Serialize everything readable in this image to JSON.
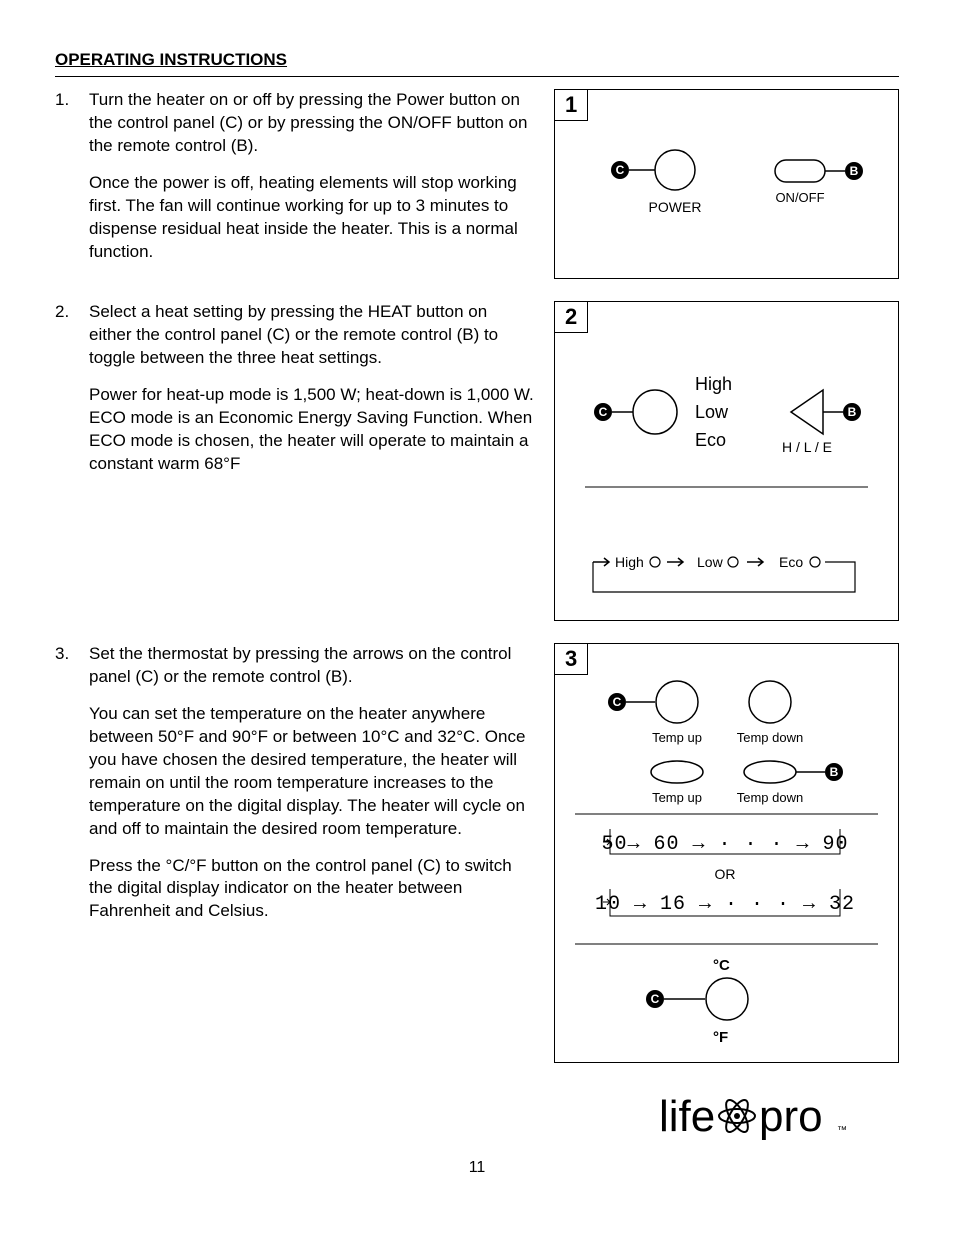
{
  "section_title": "OPERATING INSTRUCTIONS",
  "page_number": "11",
  "steps": [
    {
      "num": "1.",
      "paras": [
        "Turn the heater on or off by pressing the Power button on the control panel (C) or by pressing the ON/OFF button on the remote control (B).",
        "Once the power is off, heating elements will stop working first. The fan will continue working for up to 3 minutes to dispense residual heat inside the heater. This is a normal function."
      ]
    },
    {
      "num": "2.",
      "paras": [
        "Select a heat setting by pressing the HEAT button on either the control panel (C) or the remote control (B) to toggle between the three heat settings.",
        "Power for heat-up mode is 1,500 W; heat-down is 1,000 W. ECO mode is an Economic Energy Saving Function. When ECO mode is chosen, the heater will operate to maintain a constant warm 68°F"
      ]
    },
    {
      "num": "3.",
      "paras": [
        "Set the thermostat by pressing the arrows on the control panel (C) or the remote control (B).",
        "You can set the temperature on the heater anywhere between 50°F and 90°F or between 10°C and 32°C. Once you have chosen the desired temperature, the heater will remain on until the room temperature increases to the temperature on the digital display. The heater will cycle on and off to maintain the desired room temperature.",
        "Press the °C/°F button on the control panel (C) to switch the digital display indicator on the heater between Fahrenheit and Celsius."
      ]
    }
  ],
  "fig1": {
    "num": "1",
    "c": "C",
    "b": "B",
    "power": "POWER",
    "onoff": "ON/OFF"
  },
  "fig2": {
    "num": "2",
    "c": "C",
    "b": "B",
    "high": "High",
    "low": "Low",
    "eco": "Eco",
    "hle": "H / L / E",
    "seq_high": "High",
    "seq_low": "Low",
    "seq_eco": "Eco"
  },
  "fig3": {
    "num": "3",
    "c": "C",
    "b": "B",
    "temp_up": "Temp up",
    "temp_down": "Temp down",
    "range_f": "50→ 60 → · · · → 90",
    "or": "OR",
    "range_c": "10 → 16 → · · · → 32",
    "deg_c": "°C",
    "deg_f": "°F"
  },
  "logo": {
    "left": "life",
    "right": "pro"
  }
}
